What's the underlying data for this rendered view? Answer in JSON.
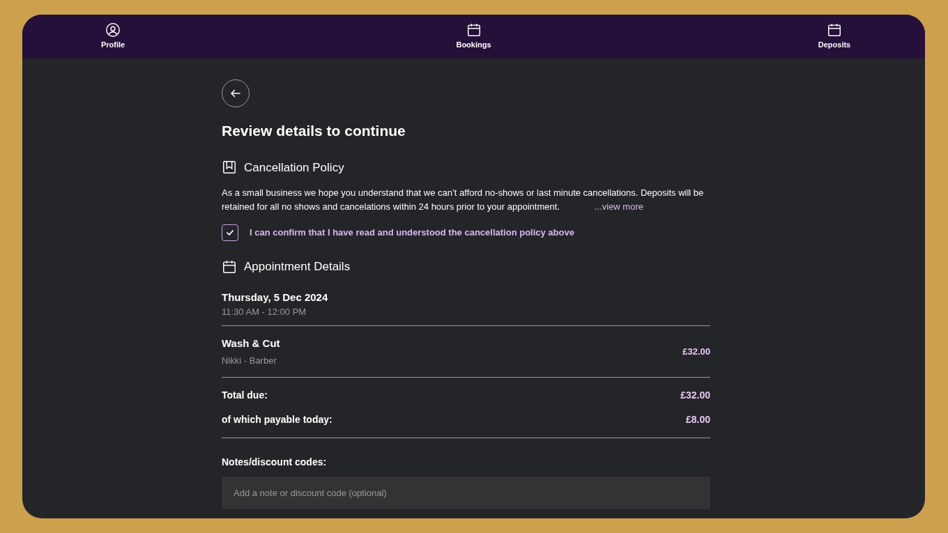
{
  "nav": [
    {
      "label": "Profile",
      "kind": "profile"
    },
    {
      "label": "Bookings",
      "kind": "calendar"
    },
    {
      "label": "Deposits",
      "kind": "calendar"
    }
  ],
  "title": "Review details to continue",
  "policy": {
    "heading": "Cancellation Policy",
    "text": "As a small business we hope you understand that we can’t afford no-shows or last minute cancellations. Deposits will be retained for all no shows and cancelations within 24 hours prior to your appointment.",
    "link": "...view more",
    "confirm": {
      "label": "I can confirm that I have read and understood the cancellation policy above",
      "checked": true
    }
  },
  "appointment": {
    "heading": "Appointment Details",
    "date": "Thursday, 5 Dec 2024",
    "time": "11:30 AM - 12:00 PM",
    "services": [
      {
        "name": "Wash & Cut",
        "staff": "Nikki - Barber",
        "price": "£32.00"
      }
    ],
    "totals": [
      {
        "label": "Total due:",
        "value": "£32.00"
      },
      {
        "label": "of which payable today:",
        "value": "£8.00"
      }
    ]
  },
  "notes": {
    "label": "Notes/discount codes:",
    "placeholder": "Add a note or discount code (optional)"
  }
}
